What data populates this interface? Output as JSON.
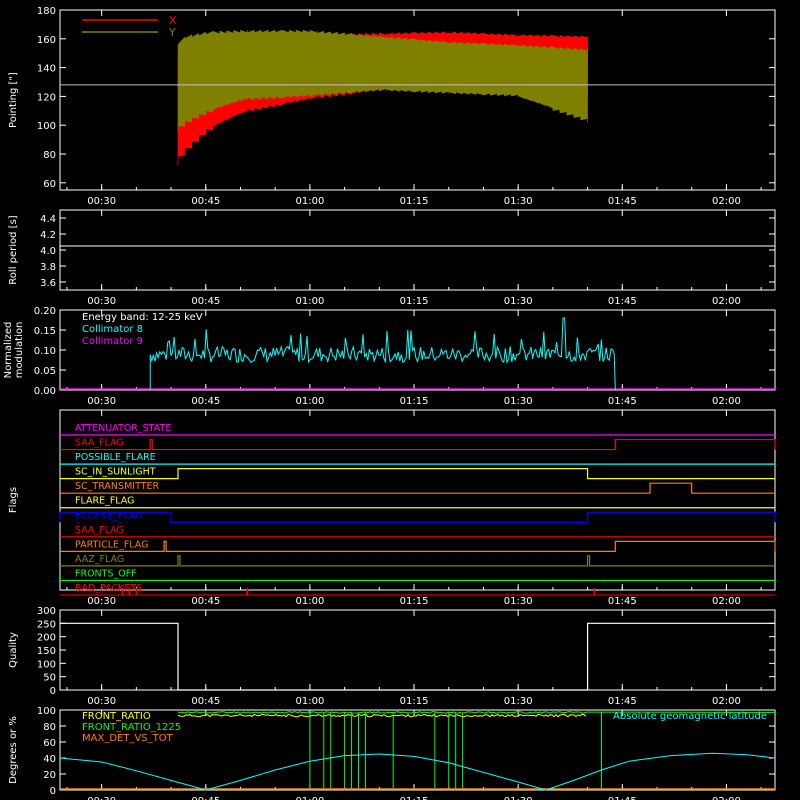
{
  "time_ticks": [
    "00:30",
    "00:45",
    "01:00",
    "01:15",
    "01:30",
    "01:45",
    "02:00"
  ],
  "chart_data": [
    {
      "id": "pointing",
      "type": "line",
      "ylabel": "Pointing [\"]",
      "ylim": [
        55,
        180
      ],
      "yticks": [
        60,
        80,
        100,
        120,
        140,
        160,
        180
      ],
      "reference_line": 128,
      "legend": {
        "placement": "top-left",
        "entries": [
          {
            "name": "X",
            "color": "#ff0000"
          },
          {
            "name": "Y",
            "color": "#808000"
          }
        ]
      },
      "series": [
        {
          "name": "X",
          "color": "#ff0000",
          "envelope": {
            "t": [
              "00:41",
              "00:42",
              "00:45",
              "00:50",
              "01:00",
              "01:10",
              "01:20",
              "01:30",
              "01:40"
            ],
            "max": [
              148,
              150,
              154,
              158,
              163,
              164,
              165,
              163,
              162
            ],
            "min": [
              72,
              80,
              95,
              108,
              118,
              124,
              124,
              124,
              121
            ]
          }
        },
        {
          "name": "Y",
          "color": "#808000",
          "envelope": {
            "t": [
              "00:41",
              "00:42",
              "00:45",
              "00:50",
              "01:00",
              "01:10",
              "01:20",
              "01:30",
              "01:40"
            ],
            "max": [
              155,
              162,
              165,
              166,
              166,
              162,
              158,
              156,
              153
            ],
            "min": [
              95,
              100,
              108,
              117,
              120,
              124,
              122,
              120,
              102
            ]
          }
        }
      ]
    },
    {
      "id": "roll-period",
      "type": "line",
      "ylabel": "Roll period [s]",
      "ylim": [
        3.5,
        4.5
      ],
      "yticks": [
        "3.6",
        "3.8",
        "4.0",
        "4.2",
        "4.4"
      ],
      "series": [
        {
          "name": "roll period",
          "color": "#ffffff",
          "value": 4.05
        }
      ]
    },
    {
      "id": "modulation",
      "type": "line",
      "ylabel": [
        "Normalized",
        "modulation"
      ],
      "ylim": [
        0,
        0.2
      ],
      "yticks": [
        "0.00",
        "0.05",
        "0.10",
        "0.15",
        "0.20"
      ],
      "legend": {
        "placement": "top-left",
        "entries": [
          {
            "name": "Energy band: 12-25 keV",
            "color": "#ffffff"
          },
          {
            "name": "Collimator 8",
            "color": "#00ffff"
          },
          {
            "name": "Collimator 9",
            "color": "#ff00ff"
          }
        ]
      },
      "series": [
        {
          "name": "Collimator 8",
          "color": "#00ffff",
          "start": "00:37",
          "end": "01:44",
          "base": 0.085,
          "max": 0.18
        },
        {
          "name": "Collimator 9",
          "color": "#ff00ff",
          "value": 0
        }
      ]
    },
    {
      "id": "flags",
      "type": "line",
      "ylabel": "Flags",
      "flags": [
        {
          "label": "ATTENUATOR_STATE",
          "color": "#ff00ff",
          "segments": []
        },
        {
          "label": "SAA_FLAG",
          "color": "#ff0000",
          "segments": [
            [
              "00:37",
              "00:37"
            ],
            [
              "01:44",
              "02:07"
            ]
          ]
        },
        {
          "label": "POSSIBLE_FLARE",
          "color": "#00ffff",
          "segments": []
        },
        {
          "label": "SC_IN_SUNLIGHT",
          "color": "#ffff00",
          "segments": [
            [
              "00:41",
              "01:40"
            ]
          ]
        },
        {
          "label": "SC_TRANSMITTER",
          "color": "#ff8000",
          "segments": [
            [
              "01:49",
              "01:55"
            ]
          ]
        },
        {
          "label": "FLARE_FLAG",
          "color": "#ffff00",
          "segments": []
        },
        {
          "label": "ECLIPSE_FLAG",
          "color": "#0000ff",
          "segments": [
            [
              "00:24",
              "00:40"
            ],
            [
              "01:40",
              "02:07"
            ]
          ]
        },
        {
          "label": "SAA_FLAG",
          "color": "#ff0000",
          "segments": []
        },
        {
          "label": "PARTICLE_FLAG",
          "color": "#ff8000",
          "segments": [
            [
              "00:39",
              "00:39"
            ],
            [
              "01:44",
              "02:07"
            ]
          ]
        },
        {
          "label": "AAZ_FLAG",
          "color": "#808000",
          "segments": [
            [
              "00:41",
              "00:41"
            ],
            [
              "01:40",
              "01:40"
            ]
          ]
        },
        {
          "label": "FRONTS_OFF",
          "color": "#00ff00",
          "segments": []
        },
        {
          "label": "BAD_PACKETS",
          "color": "#ff0000",
          "spikes": [
            "00:33",
            "00:34",
            "00:35",
            "00:51",
            "01:41"
          ]
        }
      ]
    },
    {
      "id": "quality",
      "type": "line",
      "ylabel": "Quality",
      "ylim": [
        0,
        300
      ],
      "yticks": [
        "0",
        "50",
        "100",
        "150",
        "200",
        "250",
        "300"
      ],
      "series": [
        {
          "name": "quality",
          "color": "#ffffff",
          "steps": [
            [
              "00:24",
              250
            ],
            [
              "00:41",
              0
            ],
            [
              "01:40",
              250
            ],
            [
              "02:07",
              250
            ]
          ]
        }
      ]
    },
    {
      "id": "ratios",
      "type": "line",
      "ylabel": "Degrees or %",
      "ylim": [
        0,
        100
      ],
      "yticks": [
        "0",
        "20",
        "40",
        "60",
        "80",
        "100"
      ],
      "legend": {
        "placement": "top-left",
        "entries": [
          {
            "name": "FRONT_RATIO",
            "color": "#ffff00"
          },
          {
            "name": "FRONT_RATIO_1225",
            "color": "#00ff00"
          },
          {
            "name": "MAX_DET_VS_TOT",
            "color": "#ff8000"
          }
        ]
      },
      "annotation": {
        "text": "Absolute geomagnetic latitude",
        "color": "#00ffff"
      },
      "series": [
        {
          "name": "FRONT_RATIO",
          "color": "#ffff00",
          "level": 93
        },
        {
          "name": "FRONT_RATIO_1225",
          "color": "#00ff00",
          "level": 97,
          "drops": [
            "01:00",
            "01:02",
            "01:03",
            "01:05",
            "01:06",
            "01:07",
            "01:08",
            "01:12",
            "01:18",
            "01:20",
            "01:21",
            "01:22",
            "01:42"
          ]
        },
        {
          "name": "MAX_DET_VS_TOT",
          "color": "#ff8000",
          "level": 0
        },
        {
          "name": "Absolute geomagnetic latitude",
          "color": "#00ffff",
          "points": [
            [
              "00:24",
              40
            ],
            [
              "00:30",
              35
            ],
            [
              "00:35",
              24
            ],
            [
              "00:40",
              12
            ],
            [
              "00:45",
              0
            ],
            [
              "00:50",
              12
            ],
            [
              "00:55",
              25
            ],
            [
              "01:00",
              36
            ],
            [
              "01:05",
              43
            ],
            [
              "01:10",
              45
            ],
            [
              "01:15",
              42
            ],
            [
              "01:20",
              34
            ],
            [
              "01:25",
              22
            ],
            [
              "01:30",
              10
            ],
            [
              "01:34",
              0
            ],
            [
              "01:38",
              12
            ],
            [
              "01:42",
              25
            ],
            [
              "01:46",
              36
            ],
            [
              "01:52",
              43
            ],
            [
              "01:58",
              46
            ],
            [
              "02:03",
              44
            ],
            [
              "02:07",
              40
            ]
          ]
        }
      ]
    }
  ]
}
